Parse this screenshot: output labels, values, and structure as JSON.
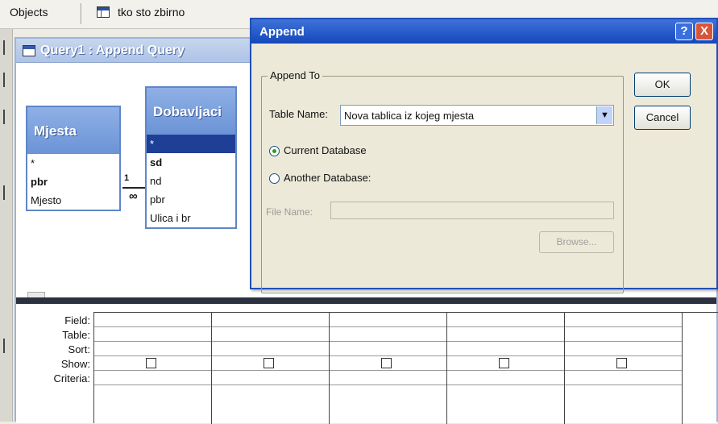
{
  "access_window": {
    "objects_label": "Objects",
    "current_table": "tko sto zbirno"
  },
  "query_window": {
    "title": "Query1 : Append Query",
    "tables": [
      {
        "name": "Mjesta",
        "fields": [
          "*",
          "pbr",
          "Mjesto"
        ]
      },
      {
        "name": "Dobavljaci",
        "fields": [
          "*",
          "sd",
          "nd",
          "pbr",
          "Ulica i br"
        ]
      }
    ],
    "join": {
      "one_side": "1",
      "many_side": "∞"
    },
    "scroll_arrow": "<"
  },
  "design_grid": {
    "row_labels": [
      "Field:",
      "Table:",
      "Sort:",
      "Show:",
      "Criteria:"
    ],
    "column_count": 5
  },
  "dialog": {
    "title": "Append",
    "help_button": "?",
    "close_button": "X",
    "group_label": "Append To",
    "table_name_label": "Table Name:",
    "table_name_value": "Nova tablica iz kojeg mjesta",
    "combo_arrow": "▼",
    "current_db_label": "Current Database",
    "current_db_checked": true,
    "another_db_label": "Another Database:",
    "another_db_checked": false,
    "file_name_label": "File Name:",
    "file_name_value": "",
    "browse_button": "Browse...",
    "ok_button": "OK",
    "cancel_button": "Cancel"
  },
  "colors": {
    "dialog_title_bg": "#1448bc",
    "table_header_bg": "#6b93d6",
    "selected_field_bg": "#1f3f96"
  }
}
